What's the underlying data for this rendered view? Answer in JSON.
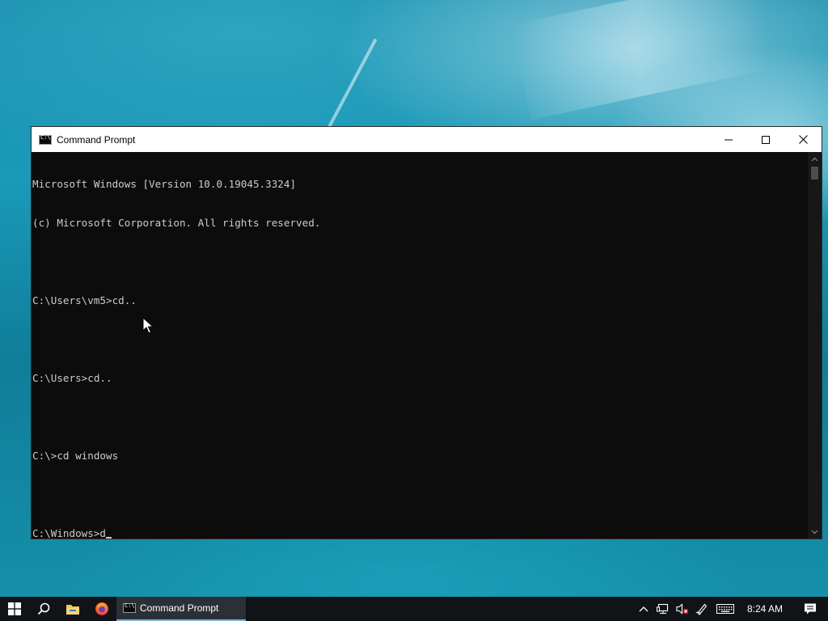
{
  "window": {
    "title": "Command Prompt",
    "controls": {
      "minimize": "minimize-icon",
      "maximize": "maximize-icon",
      "close": "close-icon"
    }
  },
  "console": {
    "lines": [
      "Microsoft Windows [Version 10.0.19045.3324]",
      "(c) Microsoft Corporation. All rights reserved.",
      "",
      "C:\\Users\\vm5>cd..",
      "",
      "C:\\Users>cd..",
      "",
      "C:\\>cd windows",
      ""
    ],
    "prompt": "C:\\Windows>",
    "input": "d"
  },
  "taskbar": {
    "start_icon": "windows-logo-icon",
    "search_icon": "search-icon",
    "file_explorer_icon": "folder-icon",
    "firefox_icon": "firefox-icon",
    "active_app": {
      "icon": "cmd-icon",
      "label": "Command Prompt"
    },
    "tray": {
      "chevron_icon": "chevron-up-icon",
      "network_icon": "network-icon",
      "volume_icon": "volume-muted-icon",
      "pen_icon": "pen-icon",
      "keyboard_icon": "keyboard-icon",
      "time": "8:24 AM",
      "notification_icon": "notification-icon"
    }
  },
  "colors": {
    "console_bg": "#0c0c0c",
    "console_fg": "#cccccc",
    "taskbar_bg": "#101418",
    "active_app_accent": "#7ab0d6"
  }
}
